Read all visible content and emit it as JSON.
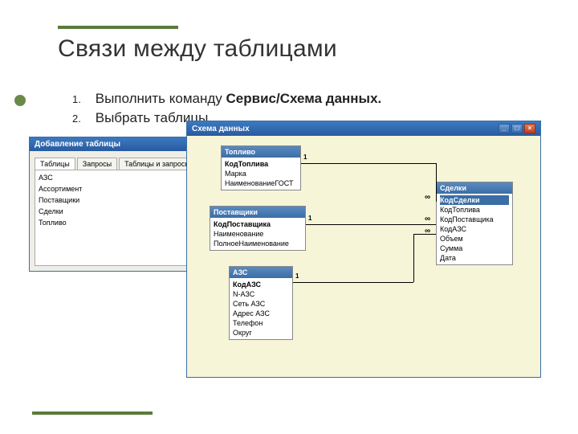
{
  "title": "Связи между таблицами",
  "steps": [
    {
      "num": "1.",
      "pre": "Выполнить команду ",
      "bold": "Сервис/Схема данных."
    },
    {
      "num": "2.",
      "text": "Выбрать таблицы."
    }
  ],
  "add_dialog": {
    "title": "Добавление таблицы",
    "tabs": [
      "Таблицы",
      "Запросы",
      "Таблицы и запросы"
    ],
    "items": [
      "АЗС",
      "Ассортимент",
      "Поставщики",
      "Сделки",
      "Топливо"
    ]
  },
  "schema": {
    "title": "Схема данных",
    "rel_one": "1",
    "rel_many": "∞",
    "tables": [
      {
        "name": "Топливо",
        "fields": [
          "КодТоплива",
          "Марка",
          "НаименованиеГОСТ"
        ]
      },
      {
        "name": "Поставщики",
        "fields": [
          "КодПоставщика",
          "Наименование",
          "ПолноеНаименование"
        ]
      },
      {
        "name": "АЗС",
        "fields": [
          "КодАЗС",
          "N-АЗС",
          "Сеть АЗС",
          "Адрес АЗС",
          "Телефон",
          "Округ"
        ]
      },
      {
        "name": "Сделки",
        "fields": [
          "КодСделки",
          "КодТоплива",
          "КодПоставщика",
          "КодАЗС",
          "Объем",
          "Сумма",
          "Дата"
        ]
      }
    ]
  }
}
